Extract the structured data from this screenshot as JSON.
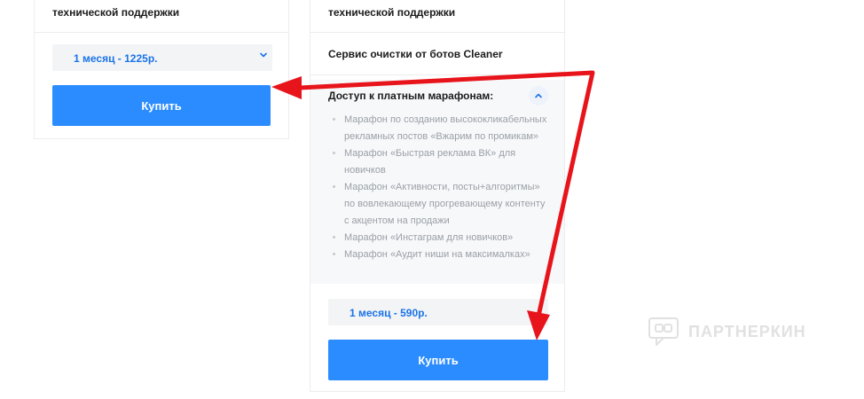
{
  "left_card": {
    "support_text": "технической поддержки",
    "plan_select": {
      "value": "1 месяц - 1225р."
    },
    "buy_label": "Купить"
  },
  "right_card": {
    "support_text": "технической поддержки",
    "cleaner_text": "Сервис очистки от ботов Cleaner",
    "marathons_title": "Доступ к платным марафонам:",
    "marathons": [
      "Марафон по созданию высококликабельных рекламных постов «Вжарим по промикам»",
      "Марафон «Быстрая реклама ВК» для новичков",
      "Марафон «Активности, посты+алгоритмы» по вовлекающему прогревающему контенту с акцентом на продажи",
      "Марафон «Инстаграм для новичков»",
      "Марафон «Аудит ниши на максималках»"
    ],
    "plan_select": {
      "value": "1 месяц - 590р."
    },
    "buy_label": "Купить"
  },
  "watermark": {
    "text": "ПАРТНЕРКИН"
  },
  "colors": {
    "accent": "#2b8cff",
    "select_text": "#1a73e8",
    "annotation_arrow": "#e8141b"
  },
  "icons": [
    "chevron-down-icon",
    "chevron-up-icon",
    "watermark-logo-icon",
    "red-annotation-arrow"
  ]
}
